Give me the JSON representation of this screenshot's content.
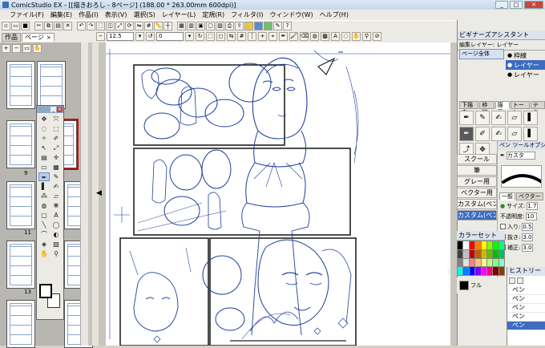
{
  "window": {
    "title": "ComicStudio EX - [[描きおろし - 8ページ] (188.00 * 263.00mm 600dpi)]",
    "controls": [
      "_",
      "□",
      "✕"
    ]
  },
  "menu": [
    "ファイル(F)",
    "編集(E)",
    "作品(I)",
    "表示(V)",
    "選択(S)",
    "レイヤー(L)",
    "定規(R)",
    "フィルタ(I)",
    "ウィンドウ(W)",
    "ヘルプ(H)"
  ],
  "doc_tabs": [
    {
      "label": "作品",
      "active": false
    },
    {
      "label": "ページ",
      "active": true,
      "close": "×"
    }
  ],
  "view": {
    "zoom": "12.5",
    "rotation": "0"
  },
  "page_panel": {
    "page_numbers": [
      "9",
      "11",
      "13"
    ]
  },
  "navigator": {
    "title": "ビギナーズアシスタント"
  },
  "layer_panel": {
    "header_labels": [
      "編集レイヤー",
      "レイヤー"
    ],
    "mode_button": "ページ全体",
    "rows": [
      {
        "label": "枠線",
        "selected": false
      },
      {
        "label": "レイヤー",
        "selected": true
      },
      {
        "label": "レイヤー",
        "selected": false
      }
    ]
  },
  "tool_tabs": [
    "下描き",
    "枠線",
    "描画",
    "トーン",
    "テキ"
  ],
  "pen_presets": [
    "スクール",
    "筆",
    "グレー用",
    "ベクター用",
    "カスタム(ペン",
    "カスタム(ペン"
  ],
  "pen_options": {
    "title": "ペン ツールオプシ",
    "preset_name": "カスタ",
    "tabs": [
      "一般",
      "ベクター"
    ],
    "props": [
      {
        "label": "サイズ:",
        "value": "1.7",
        "check": false,
        "dot": true
      },
      {
        "label": "不透明度:",
        "value": "10",
        "check": false,
        "dot": false
      },
      {
        "label": "入り:",
        "value": "0.5",
        "check": false,
        "dot": false
      },
      {
        "label": "抜き:",
        "value": "3.0",
        "check": false,
        "dot": false
      },
      {
        "label": "補正:",
        "value": "3.0",
        "check": true,
        "dot": false
      }
    ]
  },
  "palette": {
    "label": "カラーセット",
    "sub_label": "フル",
    "colors": [
      "#000000",
      "#ffffff",
      "#ff0000",
      "#ff8000",
      "#ffff00",
      "#80ff00",
      "#00ff00",
      "#00ff80",
      "#404040",
      "#c0c0c0",
      "#c00000",
      "#c06000",
      "#c0c000",
      "#60c000",
      "#00c000",
      "#00c060",
      "#808080",
      "#e0e0e0",
      "#ff8080",
      "#ffc080",
      "#ffff80",
      "#c0ff80",
      "#80ff80",
      "#80ffc0",
      "#00ffff",
      "#0080ff",
      "#0000ff",
      "#8000ff",
      "#ff00ff",
      "#ff0080",
      "#800000",
      "#804000"
    ]
  },
  "history": {
    "title": "ヒストリー",
    "items": [
      {
        "label": "ペン",
        "selected": false
      },
      {
        "label": "ペン",
        "selected": false
      },
      {
        "label": "ペン",
        "selected": false
      },
      {
        "label": "ペン",
        "selected": false
      },
      {
        "label": "ペン",
        "selected": true
      }
    ]
  }
}
